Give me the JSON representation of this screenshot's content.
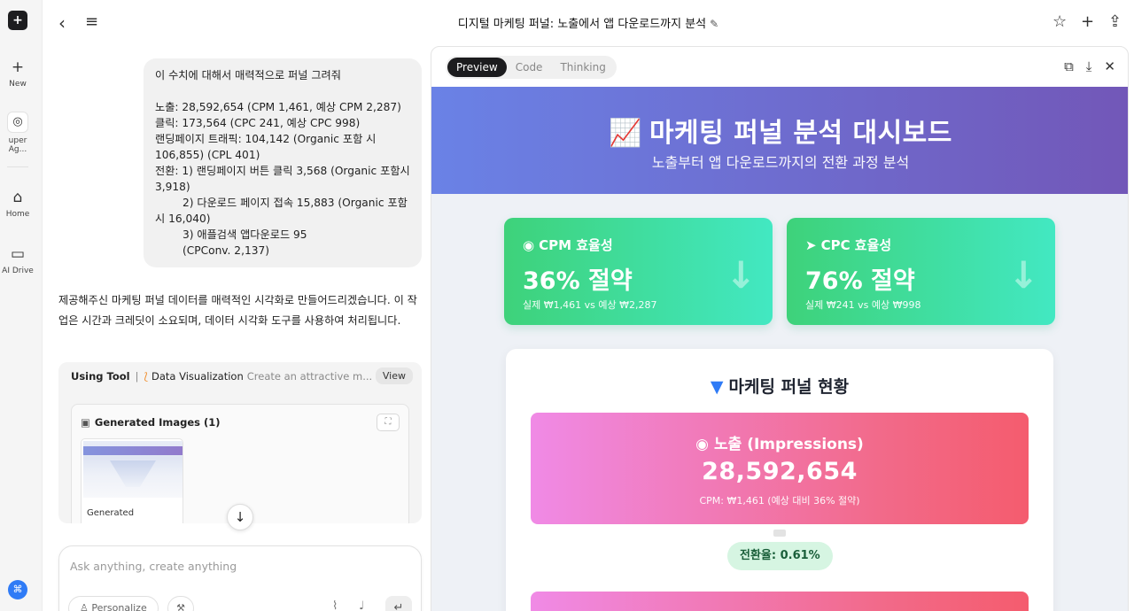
{
  "rail": {
    "logo": "+",
    "items": [
      {
        "icon": "plus-icon",
        "glyph": "+",
        "label": "New"
      },
      {
        "icon": "super-agent-icon",
        "glyph": "◎",
        "label": "uper Ag..."
      },
      {
        "icon": "home-icon",
        "glyph": "⌂",
        "label": "Home"
      },
      {
        "icon": "ai-drive-icon",
        "glyph": "▭",
        "label": "AI Drive"
      }
    ],
    "gift_icon": "gift-icon"
  },
  "topbar": {
    "title": "디지털 마케팅 퍼널: 노출에서 앱 다운로드까지 분석",
    "icons": [
      "back-icon",
      "menu-icon",
      "edit-icon",
      "star-icon",
      "plus-icon",
      "share-icon"
    ]
  },
  "chat": {
    "user_message": "이 수치에 대해서 매력적으로 퍼널 그려줘\n\n노출: 28,592,654 (CPM 1,461, 예상 CPM 2,287)\n클릭: 173,564 (CPC 241, 예상 CPC 998)\n랜딩페이지 트래픽: 104,142 (Organic 포함 시\n106,855) (CPL 401)\n전환: 1) 랜딩페이지 버튼 클릭 3,568 (Organic 포함시\n3,918)\n        2) 다운로드 페이지 접속 15,883 (Organic 포함\n시 16,040)\n        3) 애플검색 앱다운로드 95\n        (CPConv. 2,137)",
    "assistant_reply": "제공해주신 마케팅 퍼널 데이터를 매력적인 시각화로 만들어드리겠습니다. 이 작업은 시간과 크레딧이 소요되며, 데이터 시각화 도구를 사용하여 처리됩니다.",
    "tool": {
      "using_label": "Using Tool",
      "divider": "|",
      "name": "Data Visualization",
      "description": "Create an attractive m...",
      "view_label": "View"
    },
    "generated": {
      "title": "Generated Images (1)",
      "thumb_label": "Generated"
    },
    "input": {
      "placeholder": "Ask anything, create anything",
      "personalize_label": "Personalize"
    }
  },
  "preview": {
    "tabs": [
      {
        "label": "Preview",
        "active": true
      },
      {
        "label": "Code",
        "active": false
      },
      {
        "label": "Thinking",
        "active": false
      }
    ],
    "actions": [
      "open-external-icon",
      "download-icon",
      "close-icon"
    ],
    "page": {
      "hero_title": "마케팅 퍼널 분석 대시보드",
      "hero_subtitle": "노출부터 앱 다운로드까지의 전환 과정 분석",
      "cards": [
        {
          "title": "CPM 효율성",
          "value": "36% 절약",
          "sub": "실제 ₩1,461 vs 예상 ₩2,287"
        },
        {
          "title": "CPC 효율성",
          "value": "76% 절약",
          "sub": "실제 ₩241 vs 예상 ₩998"
        }
      ],
      "funnel_title": "마케팅 퍼널 현황",
      "stage": {
        "label": "노출 (Impressions)",
        "value": "28,592,654",
        "note": "CPM: ₩1,461 (예상 대비 36% 절약)"
      },
      "conversion_rate": "전환율: 0.61%"
    }
  },
  "colors": {
    "hero_start": "#6a82e6",
    "hero_end": "#7257b8",
    "card_green": "#3ed27a",
    "stage_pink": "#f26a8a",
    "funnel_icon": "#2f7bf6"
  }
}
